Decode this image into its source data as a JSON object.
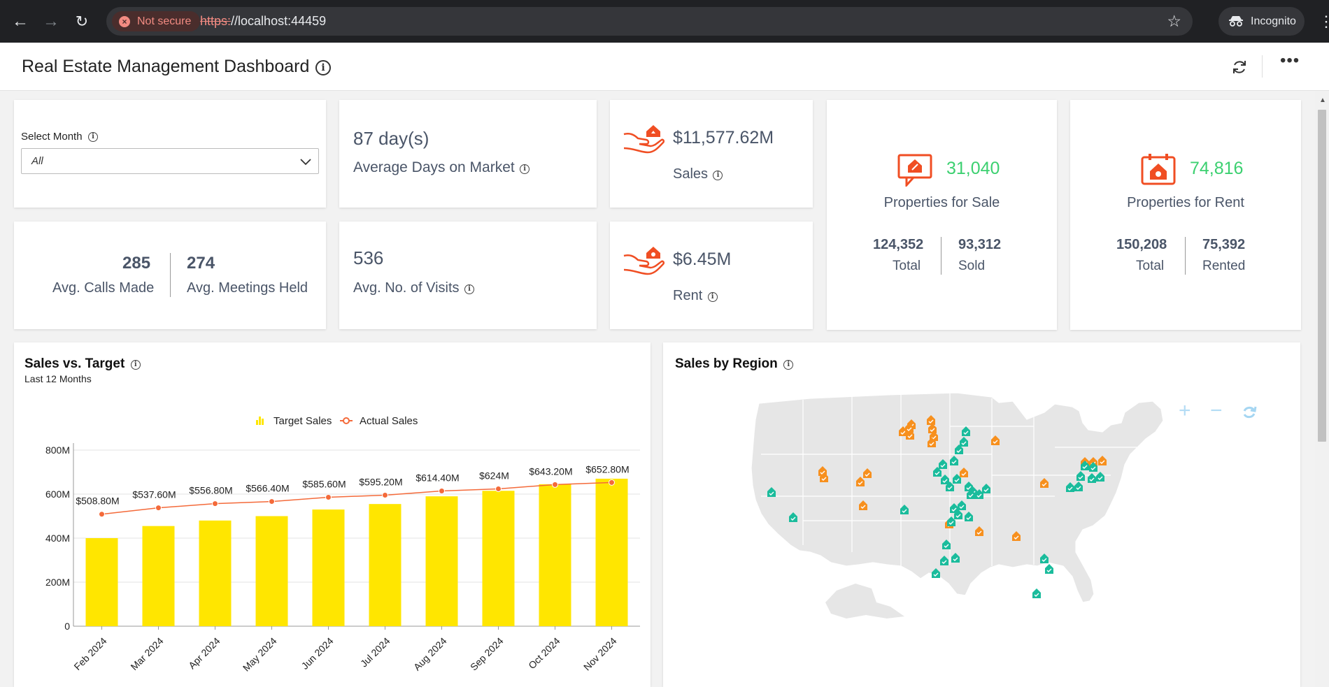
{
  "browser": {
    "security_label": "Not secure",
    "url_scheme": "https:",
    "url_rest": "//localhost:44459",
    "incognito_label": "Incognito"
  },
  "header": {
    "title": "Real Estate Management Dashboard"
  },
  "filter": {
    "label": "Select Month",
    "value": "All"
  },
  "kpis": {
    "days_on_market": {
      "value": "87 day(s)",
      "label": "Average Days on Market"
    },
    "sales": {
      "value": "$11,577.62M",
      "label": "Sales"
    },
    "rent": {
      "value": "$6.45M",
      "label": "Rent"
    },
    "calls": {
      "value": "285",
      "label": "Avg. Calls Made"
    },
    "meetings": {
      "value": "274",
      "label": "Avg. Meetings Held"
    },
    "visits": {
      "value": "536",
      "label": "Avg. No. of Visits"
    },
    "for_sale": {
      "value": "31,040",
      "label": "Properties for Sale",
      "total": "124,352",
      "total_label": "Total",
      "sold": "93,312",
      "sold_label": "Sold"
    },
    "for_rent": {
      "value": "74,816",
      "label": "Properties for Rent",
      "total": "150,208",
      "total_label": "Total",
      "rented": "75,392",
      "rented_label": "Rented"
    }
  },
  "colors": {
    "accent_orange": "#f04e23",
    "green": "#3cd070",
    "bar_yellow": "#ffe600",
    "line_orange": "#f46a3a",
    "marker_orange": "#f7901e",
    "marker_teal": "#1abc9c"
  },
  "sales_chart": {
    "title": "Sales vs. Target",
    "subtitle": "Last 12 Months",
    "legend_target": "Target Sales",
    "legend_actual": "Actual Sales"
  },
  "region_map": {
    "title": "Sales by Region"
  },
  "chart_data": {
    "type": "bar",
    "title": "Sales vs. Target",
    "subtitle": "Last 12 Months",
    "categories": [
      "Feb 2024",
      "Mar 2024",
      "Apr 2024",
      "May 2024",
      "Jun 2024",
      "Jul 2024",
      "Aug 2024",
      "Sep 2024",
      "Oct 2024",
      "Nov 2024"
    ],
    "series": [
      {
        "name": "Target Sales",
        "type": "bar",
        "values": [
          400,
          455,
          480,
          500,
          530,
          555,
          590,
          615,
          645,
          670
        ]
      },
      {
        "name": "Actual Sales",
        "type": "line",
        "values": [
          508.8,
          537.6,
          556.8,
          566.4,
          585.6,
          595.2,
          614.4,
          624,
          643.2,
          652.8
        ],
        "labels": [
          "$508.80M",
          "$537.60M",
          "$556.80M",
          "$566.40M",
          "$585.60M",
          "$595.20M",
          "$614.40M",
          "$624M",
          "$643.20M",
          "$652.80M"
        ]
      }
    ],
    "yticks": [
      "0",
      "200M",
      "400M",
      "600M",
      "800M"
    ],
    "ylim": [
      0,
      800
    ],
    "grid": true,
    "legend": "top-center"
  }
}
